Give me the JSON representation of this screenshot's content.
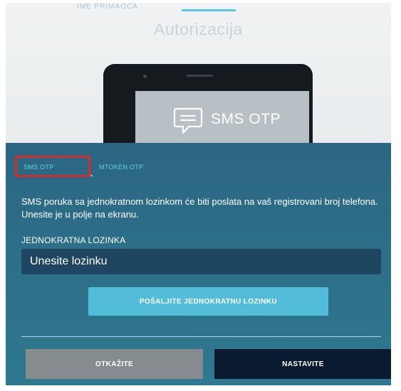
{
  "hero": {
    "faded_label": "IME PRIMAOCA",
    "title": "Autorizacija",
    "sms_label": "SMS OTP",
    "sms_icon": "chat-bubble-icon",
    "phone_icon": "smartphone-icon"
  },
  "tabs": [
    {
      "label": "SMS OTP",
      "active": true
    },
    {
      "label": "MTOKEN OTP",
      "active": false
    }
  ],
  "description": "SMS poruka sa jednokratnom lozinkom će biti poslata na vaš registrovani broj telefona. Unesite je u polje na ekranu.",
  "field": {
    "label": "JEDNOKRATNA LOZINKA",
    "placeholder": "Unesite lozinku",
    "value": ""
  },
  "buttons": {
    "send": "POŠALJITE JEDNOKRATNU LOZINKU",
    "cancel": "OTKAŽITE",
    "continue": "NASTAVITE"
  },
  "colors": {
    "panel": "#2c6a83",
    "accent": "#53bdd9",
    "tab_text": "#63d0e6",
    "highlight": "#d82b2b",
    "input_bg": "#1e4660",
    "cancel_bg": "#858b8f",
    "continue_bg": "#0a1a31"
  }
}
